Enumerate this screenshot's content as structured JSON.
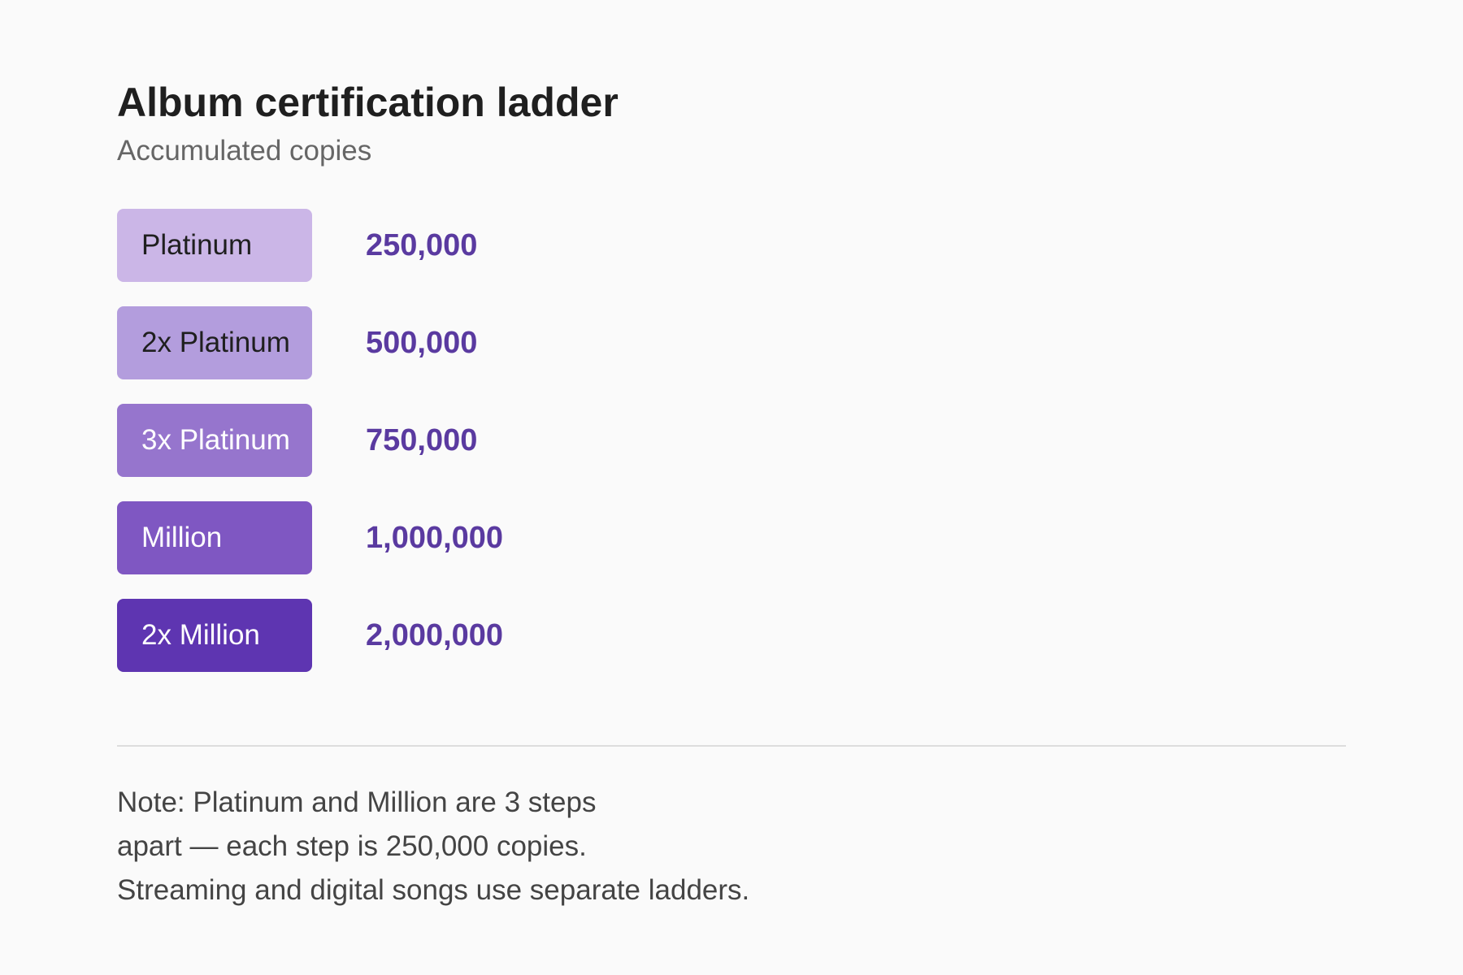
{
  "header": {
    "title": "Album certification ladder",
    "subtitle": "Accumulated copies"
  },
  "ladder": {
    "tiers": [
      {
        "label": "Platinum",
        "value": "250,000",
        "color": "#cbb6e7"
      },
      {
        "label": "2x Platinum",
        "value": "500,000",
        "color": "#b39ddd"
      },
      {
        "label": "3x Platinum",
        "value": "750,000",
        "color": "#9675cd"
      },
      {
        "label": "Million",
        "value": "1,000,000",
        "color": "#7f57c2"
      },
      {
        "label": "2x Million",
        "value": "2,000,000",
        "color": "#5e35b1"
      }
    ],
    "value_color": "#5a3aa0"
  },
  "note": {
    "lines": [
      "Note: Platinum and Million are 3 steps",
      "apart — each step is 250,000 copies.",
      "Streaming and digital songs use separate ladders."
    ]
  }
}
